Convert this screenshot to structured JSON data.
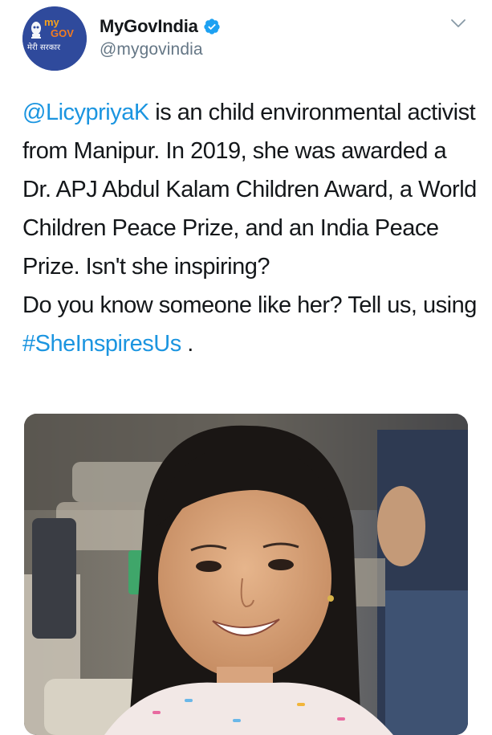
{
  "account": {
    "display_name": "MyGovIndia",
    "handle": "@mygovindia",
    "verified": true,
    "avatar": {
      "logo_text_top": "my",
      "logo_text_bottom": "GOV",
      "logo_subtext": "मेरी सरकार"
    }
  },
  "tweet": {
    "mention": "@LicypriyaK",
    "text_part1": " is an child environmental activist from Manipur. In 2019, she was awarded a Dr. APJ Abdul Kalam Children Award, a World Children Peace Prize, and an India Peace Prize. Isn't she inspiring?",
    "text_part2": "Do you know someone like her? Tell us, using ",
    "hashtag": "#SheInspiresUs",
    "text_end": " ."
  },
  "icons": {
    "verified": "verified-badge-icon",
    "menu": "chevron-down-icon"
  },
  "colors": {
    "link": "#1b95e0",
    "verified": "#1da1f2",
    "handle": "#657786",
    "text": "#14171a",
    "avatar_bg": "#2f4a9c"
  }
}
